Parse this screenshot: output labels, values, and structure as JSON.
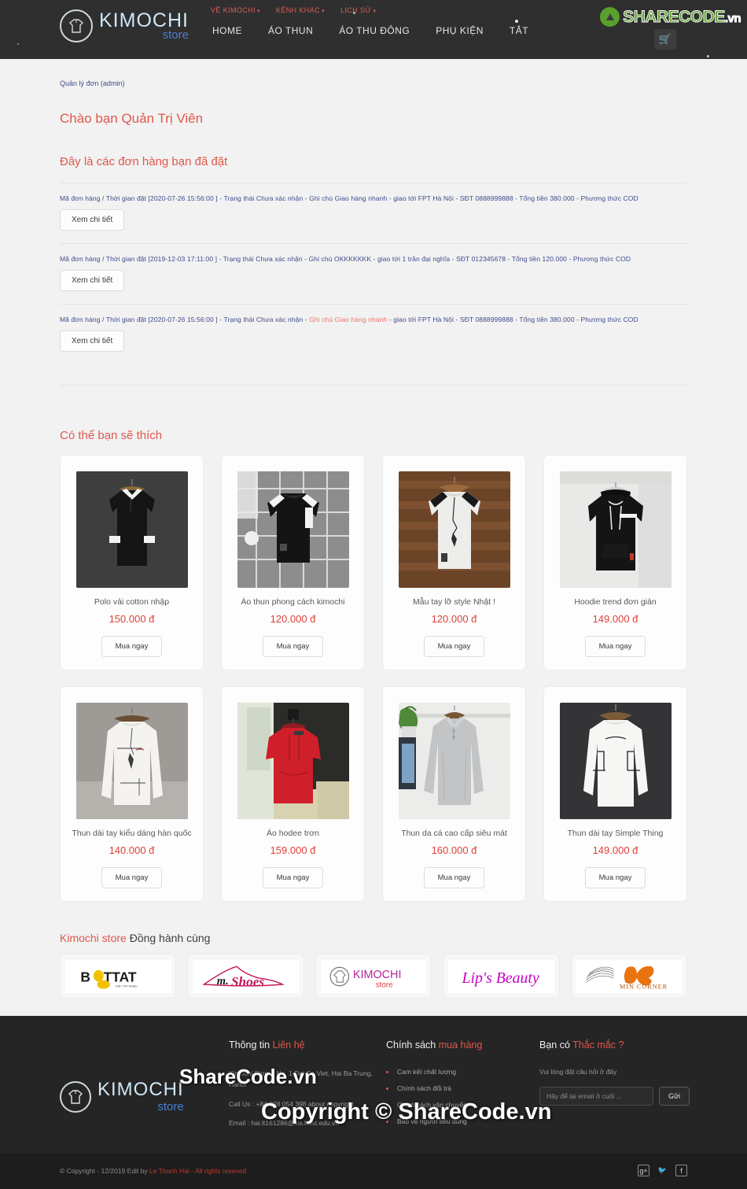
{
  "header": {
    "brand": {
      "line1": "KIMOCHI",
      "line2": "store"
    },
    "top_links": [
      {
        "label": "VỀ KIMOCHI",
        "caret": "▾"
      },
      {
        "label": "KÊNH KHÁC",
        "caret": "▾"
      },
      {
        "label": "LỊCH SỬ",
        "caret": "▾"
      }
    ],
    "main_nav": [
      {
        "label": "HOME"
      },
      {
        "label": "ÁO THUN"
      },
      {
        "label": "ÁO THU ĐÔNG"
      },
      {
        "label": "PHỤ KIỆN"
      },
      {
        "label": "TẮT"
      }
    ],
    "cart_icon": "🛒",
    "watermark": {
      "text": "SHARECODE",
      "suffix": ".vn"
    }
  },
  "main": {
    "breadcrumb": "Quản lý đơn (admin)",
    "greeting": "Chào bạn Quản Trị Viên",
    "subtitle": "Đây là các đơn hàng bạn đã đặt",
    "detail_button_label": "Xem chi tiết",
    "orders": [
      {
        "prefix": "Mã đơn hàng / Thời gian đặt [2020-07-26 15:56:00 ] - Trạng thái Chưa xác nhận - Ghi chú Giao hàng nhanh - giao tới FPT Hà Nội - SĐT 0888999888 - Tổng tiền 380.000 - Phương thức COD",
        "highlight": "",
        "suffix": ""
      },
      {
        "prefix": "Mã đơn hàng / Thời gian đặt [2019-12-03 17:11:00 ] - Trạng thái Chưa xác nhận - Ghi chú OKKKKKKK - giao tới 1 trần đại nghĩa - SĐT 012345678 - Tổng tiền 120.000 - Phương thức COD",
        "highlight": "",
        "suffix": ""
      },
      {
        "prefix": "Mã đơn hàng / Thời gian đặt [2020-07-26 15:56:00 ] - Trạng thái Chưa xác nhận - ",
        "highlight": "Ghi chú Giao hàng nhanh",
        "suffix": " - giao tới FPT Hà Nội - SĐT 0888999888 - Tổng tiền 380.000 - Phương thức COD"
      }
    ]
  },
  "recommend": {
    "title": "Có thể bạn sẽ thích",
    "buy_label": "Mua ngay",
    "products": [
      {
        "name": "Polo vải cotton nhập",
        "price": "150.000 đ",
        "image": "polo-black"
      },
      {
        "name": "Áo thun phong cách kimochi",
        "price": "120.000 đ",
        "image": "tee-black-stripe"
      },
      {
        "name": "Mẫu tay lỡ style Nhật !",
        "price": "120.000 đ",
        "image": "tee-white-wood"
      },
      {
        "name": "Hoodie trend đơn giản",
        "price": "149.000 đ",
        "image": "hoodie-black"
      },
      {
        "name": "Thun dài tay kiểu dáng hàn quốc",
        "price": "140.000 đ",
        "image": "longsleeve-white"
      },
      {
        "name": "Áo hodee trơn",
        "price": "159.000 đ",
        "image": "hoodie-red"
      },
      {
        "name": "Thun da cá cao cấp siêu mát",
        "price": "160.000 đ",
        "image": "polo-grey-long"
      },
      {
        "name": "Thun dài tay Simple Thing",
        "price": "149.000 đ",
        "image": "sweat-white-simple"
      }
    ]
  },
  "partners": {
    "title_accent": "Kimochi store",
    "title_rest": " Đồng hành cùng",
    "items": [
      {
        "name": "BITTAT",
        "logo": "bittat"
      },
      {
        "name": "mr.Shoes",
        "logo": "mrshoes"
      },
      {
        "name": "KIMOCHI store",
        "logo": "kimochi"
      },
      {
        "name": "Lip's Beauty",
        "logo": "lipsbeauty"
      },
      {
        "name": "MIN CORNER",
        "logo": "mincorner"
      }
    ]
  },
  "footer": {
    "logo": {
      "line1": "KIMOCHI",
      "line2": "store"
    },
    "contact": {
      "title_plain": "Thông tin ",
      "title_accent": "Liên hệ",
      "address": "Kimochi Store - No. 1 Dai Co Viet, Hai Ba Trung, Hanoi",
      "phone": "Call Us : +84 398 054 398 about copyright",
      "email": "Email : hai.lt161286@sis.hust.edu.vn"
    },
    "policy": {
      "title_plain": "Chính sách ",
      "title_accent": "mua hàng",
      "items": [
        "Cam kết chất lượng",
        "Chính sách đổi trả",
        "Chính sách vận chuyển",
        "Bảo vệ người tiêu dùng"
      ]
    },
    "question": {
      "title_plain": "Bạn có ",
      "title_accent": "Thắc mắc ?",
      "hint": "Vui lòng đặt câu hỏi ở đây",
      "placeholder": "Hãy để lại email ở cuối ...",
      "send_label": "Gửi"
    },
    "watermark_center": "ShareCode.vn",
    "watermark_big": "Copyright © ShareCode.vn",
    "copyright_prefix": "© Copyright - 12/2019 Edit by ",
    "copyright_author": "Le Thanh Hai - All rights reseved",
    "social": [
      {
        "name": "google-plus-icon",
        "glyph": "g+"
      },
      {
        "name": "twitter-icon",
        "glyph": "🐦"
      },
      {
        "name": "facebook-icon",
        "glyph": "f"
      }
    ]
  }
}
